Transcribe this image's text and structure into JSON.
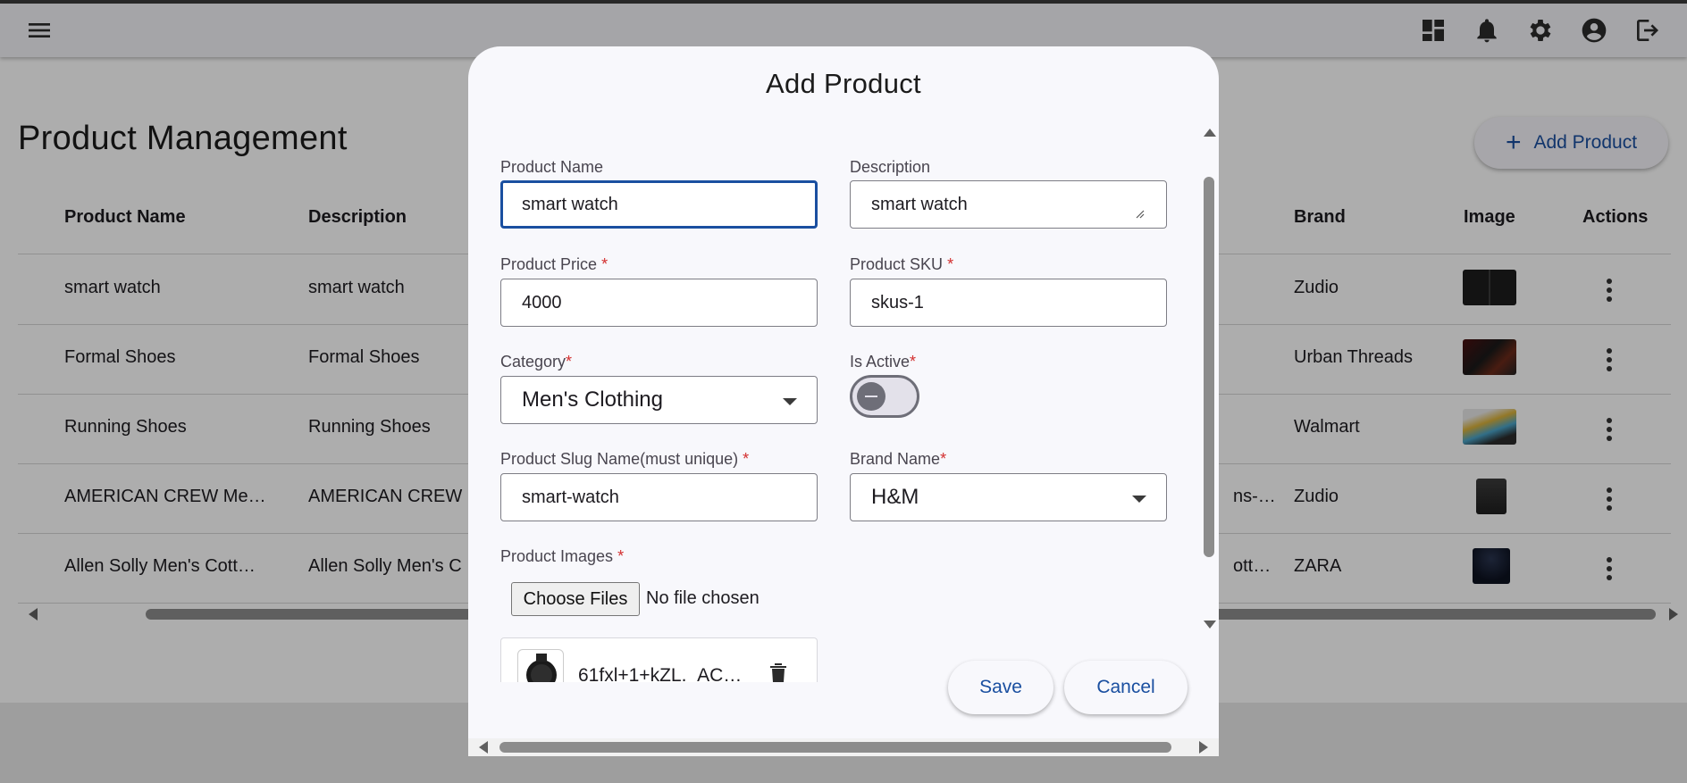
{
  "appbar": {
    "icons": [
      "menu-icon",
      "dashboard-icon",
      "bell-icon",
      "gear-icon",
      "account-icon",
      "logout-icon"
    ]
  },
  "page": {
    "title": "Product Management",
    "add_button_label": "Add Product"
  },
  "table": {
    "columns": [
      "Product Name",
      "Description",
      "Brand",
      "Image",
      "Actions"
    ],
    "rows": [
      {
        "name": "smart watch",
        "description": "smart watch",
        "hidden_tail": "",
        "brand": "Zudio",
        "image": "watch-thumbnail"
      },
      {
        "name": "Formal Shoes",
        "description": "Formal Shoes",
        "hidden_tail": "",
        "brand": "Urban Threads",
        "image": "shoes-thumbnail"
      },
      {
        "name": "Running Shoes",
        "description": "Running Shoes",
        "hidden_tail": "",
        "brand": "Walmart",
        "image": "sneaker-thumbnail"
      },
      {
        "name": "AMERICAN CREW Me…",
        "description": "AMERICAN CREW",
        "hidden_tail": "ns-…",
        "brand": "Zudio",
        "image": "pants-thumbnail"
      },
      {
        "name": "Allen Solly Men's Cott…",
        "description": "Allen Solly Men's C",
        "hidden_tail": "ott…",
        "brand": "ZARA",
        "image": "tshirt-thumbnail"
      }
    ]
  },
  "dialog": {
    "title": "Add Product",
    "labels": {
      "product_name": "Product Name",
      "description": "Description",
      "product_price": "Product Price",
      "product_sku": "Product SKU",
      "category": "Category",
      "is_active": "Is Active",
      "slug": "Product Slug Name(must unique)",
      "brand_name": "Brand Name",
      "product_images": "Product Images",
      "required_mark": "*"
    },
    "values": {
      "product_name": "smart watch",
      "description": "smart watch",
      "product_price": "4000",
      "product_sku": "skus-1",
      "category": "Men's Clothing",
      "slug": "smart-watch",
      "brand_name": "H&M"
    },
    "is_active": false,
    "file_button_label": "Choose Files",
    "file_status": "No file chosen",
    "uploaded_image_name": "61fxl+1+kZL._AC…",
    "save_label": "Save",
    "cancel_label": "Cancel"
  },
  "colors": {
    "accent": "#1a4fa0",
    "required": "#d32f2f",
    "overlay": "rgba(0,0,0,0.32)"
  }
}
